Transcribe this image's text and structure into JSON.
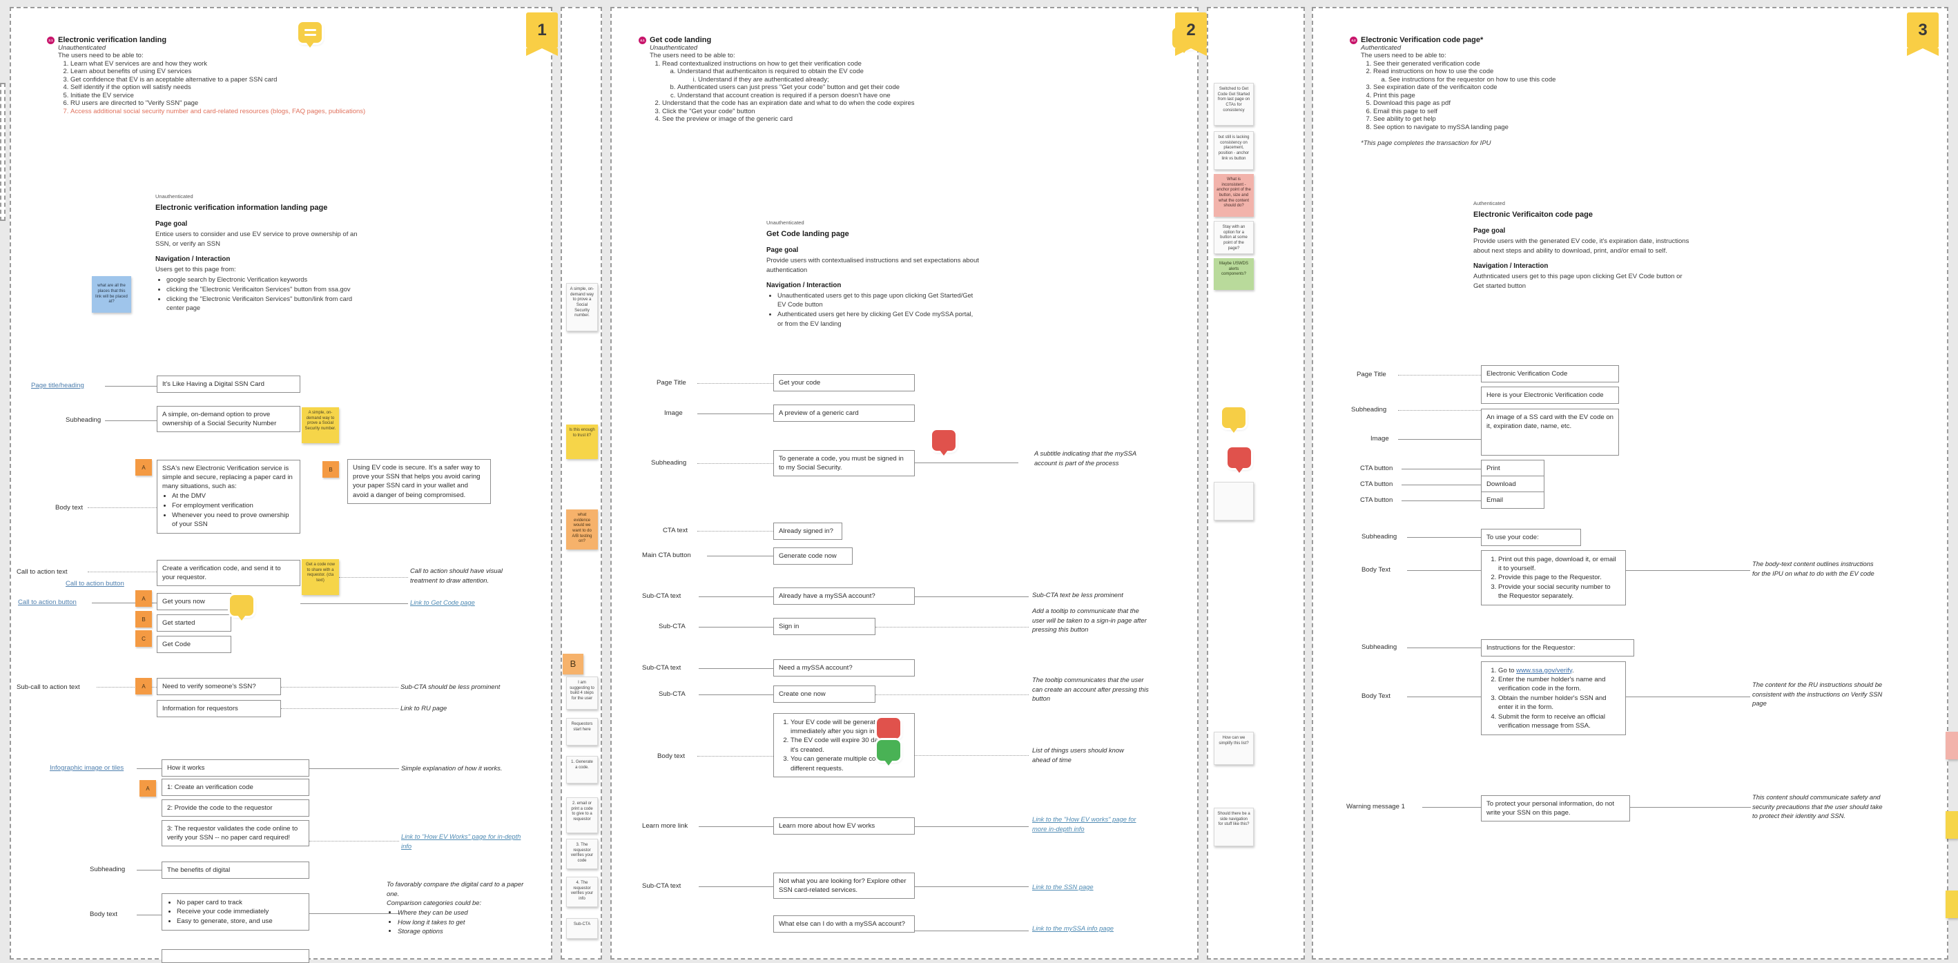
{
  "board": {
    "frames": [
      {
        "badge": "1"
      },
      {
        "badge": "2"
      },
      {
        "badge": "3"
      }
    ]
  },
  "panel1": {
    "header": {
      "number": "2.1",
      "title": "Electronic verification landing",
      "auth": "Unauthenticated",
      "intro": "The users need to be able to:",
      "items": [
        "Learn what EV services are and how they work",
        "Learn about benefits of using EV services",
        "Get confidence that EV is an aceptable alternative to a paper SSN card",
        "Self identify if the option will satisfy needs",
        "Initiate the EV service",
        "RU users are direcrted to \"Verify SSN\" page",
        "Access additional social security number and card-related resources (blogs, FAQ pages, publications)"
      ]
    },
    "goal": {
      "auth": "Unauthenticated",
      "page_name": "Electronic verification information landing page",
      "goal_label": "Page goal",
      "goal_text": "Entice users to consider and use EV service to prove ownership of an SSN, or verify an SSN",
      "nav_label": "Navigation / Interaction",
      "nav_intro": "Users get to this page from:",
      "nav_items": [
        "google search by Electronic Verification keywords",
        "clicking the \"Electronic Verificaiton Services\" button from ssa.gov",
        "clicking the \"Electronic Verificaiton Services\" button/link from card center page"
      ]
    },
    "labels": {
      "page_title": "Page title/heading",
      "subheading": "Subheading",
      "body_text": "Body text",
      "cta_text": "Call to action text",
      "cta_button": "Call to action button",
      "cta_button2": "Call to action button",
      "sub_cta_text": "Sub-call to action text",
      "infographic": "Infographic image or tiles",
      "subheading2": "Subheading",
      "body_text2": "Body text"
    },
    "boxes": {
      "page_title": "It's Like Having a Digital SSN Card",
      "subheading": "A simple, on-demand option to prove ownership of a Social Security Number",
      "body_a_intro": "SSA's new Electronic Verification service is simple and secure, replacing a paper card in many situations, such as:",
      "body_a_items": [
        "At the DMV",
        "For employment verification",
        "Whenever you need to prove ownership of your SSN"
      ],
      "body_b": "Using EV code is secure. It's a safer way to prove your SSN that helps you avoid caring your paper SSN card in your wallet and avoid a danger of being compromised.",
      "cta_text": "Create a verification code, and send it to your requestor.",
      "cta_a": "Get yours now",
      "cta_b": "Get started",
      "cta_c": "Get Code",
      "sub_cta_a": "Need to verify someone's SSN?",
      "sub_cta_b": "Information for requestors",
      "infographic": "How it works",
      "step1": "1: Create an  verification code",
      "step2": "2: Provide the code to the requestor",
      "step3": "3: The requestor validates the code online to verify your SSN -- no paper card required!",
      "subheading2": "The benefits of digital",
      "benefits": [
        "No paper card to track",
        "Receive your code immediately",
        "Easy to generate, store, and use"
      ]
    },
    "annotations": {
      "cta_visual": "Call to action should have visual treatment to draw attention.",
      "link_getcode": "Link to Get Code page",
      "sub_cta_prominent": "Sub-CTA should be less prominent",
      "link_ru": "Link to RU page",
      "simple_explanation": "Simple explanation of how it works.",
      "link_how_ev": "Link to \"How EV Works\" page for in-depth info",
      "compare_intro": "To favorably compare the digital card to a paper one.",
      "compare_intro2": "Comparison categories could be:",
      "compare_items": [
        "Where they can be used",
        "How long it takes to get",
        "Storage options"
      ]
    },
    "stickies": {
      "blue_link_places": "what are all the places that this link will be placed at?",
      "yellow_subhead": "A simple, on-demand way to prove a Social Security number.",
      "yellow_cta": "Get a code now to share with a requestor. (cta text)"
    },
    "vtabs": [
      "A",
      "B",
      "A",
      "B",
      "C",
      "A",
      "A"
    ]
  },
  "panel2": {
    "header": {
      "number": "4.1",
      "title": "Get code landing",
      "auth": "Unauthenticated",
      "intro": "The users need to be able to:",
      "items": [
        {
          "text": "Read contextualized instructions on how to get their verification code",
          "sub": [
            {
              "text": "Understand that authenticaiton is required to obtain the EV code",
              "sub": [
                "Understand if they are authenticated already;"
              ]
            },
            {
              "text": "Authenticated users can just press \"Get your code\" button and get their code",
              "sub": []
            },
            {
              "text": "Understand that account creation is required if a person doesn't have one",
              "sub": []
            }
          ]
        },
        {
          "text": "Understand that the code has an expiration date and what to do when the code expires",
          "sub": []
        },
        {
          "text": "Click the \"Get your code\" button",
          "sub": []
        },
        {
          "text": "See the preview or image of the generic card",
          "sub": []
        }
      ]
    },
    "goal": {
      "auth": "Unauthenticated",
      "page_name": "Get Code landing page",
      "goal_label": "Page goal",
      "goal_text": "Provide users with contextualised instructions and set expectations about authentication",
      "nav_label": "Navigation / Interaction",
      "nav_items": [
        "Unauthenticated users get to this page upon clicking Get Started/Get EV Code button",
        "Authenticated users get here by clicking Get EV Code mySSA portal, or from the EV landing"
      ]
    },
    "labels": {
      "page_title": "Page Title",
      "image": "Image",
      "subheading": "Subheading",
      "cta_text": "CTA text",
      "main_cta": "Main CTA button",
      "sub_cta_text1": "Sub-CTA text",
      "sub_cta1": "Sub-CTA",
      "sub_cta_text2": "Sub-CTA text",
      "sub_cta2": "Sub-CTA",
      "body_text": "Body text",
      "learn_more": "Learn more link",
      "sub_cta_text3": "Sub-CTA text"
    },
    "boxes": {
      "page_title": "Get your code",
      "image": "A preview of a generic card",
      "subheading": "To generate a code, you must be signed in to my Social Security.",
      "cta_text": "Already signed in?",
      "main_cta": "Generate code now",
      "sub_cta_text1": "Already have a mySSA account?",
      "sub_cta1": "Sign in",
      "sub_cta_text2": "Need a mySSA account?",
      "sub_cta2": "Create one now",
      "body_items": [
        "Your EV code will be generated immediately after you sign in.",
        "The EV code will expire 30 days after it's created.",
        "You can generate multiple codes for different requests."
      ],
      "learn_more": "Learn more about how EV works",
      "sub_cta_text3": "Not what you are looking for? Explore other SSN card-related services.",
      "myssa_q": "What else can I do with a mySSA account?"
    },
    "annotations": {
      "subtitle_note": "A subtitle indicating that the mySSA account is part of the process",
      "sub_cta_prominent": "Sub-CTA text be less prominent",
      "tooltip_signin": "Add a tooltip to communicate that the user will be taken to a sign-in page after pressing this button",
      "tooltip_create": "The tooltip communicates that the user can create an account after pressing this button",
      "list_of_things": "List of things users should know ahead of time",
      "link_how_ev": "Link to the \"How EV works\" page for  more in-depth info",
      "link_ssn": "Link to the SSN page",
      "link_myssa": "Link to the mySSA info page"
    }
  },
  "panel3": {
    "header": {
      "number": "4.2",
      "title": "Electronic Verification code page*",
      "auth": "Authenticated",
      "intro": "The users need to be able to:",
      "items": [
        {
          "text": "See their generated verification code",
          "sub": []
        },
        {
          "text": "Read instructions on how to use the code",
          "sub": [
            "See instructions for the requestor on how to use this code"
          ]
        },
        {
          "text": "See expiration date of the verificaiton code",
          "sub": []
        },
        {
          "text": "Print this page",
          "sub": []
        },
        {
          "text": "Download this page as pdf",
          "sub": []
        },
        {
          "text": "Email this page to self",
          "sub": []
        },
        {
          "text": "See ability to get help",
          "sub": []
        },
        {
          "text": "See option to navigate to mySSA landing page",
          "sub": []
        }
      ],
      "footnote": "*This page completes the transaction for IPU"
    },
    "goal": {
      "auth": "Authenticated",
      "page_name": "Electronic Verificaiton code page",
      "goal_label": "Page goal",
      "goal_text": "Provide users with the generated EV code, it's expiration date, instructions about next steps and ability to download, print, and/or email to self.",
      "nav_label": "Navigation / Interaction",
      "nav_text": "Authnticated users get to this page upon clicking Get EV Code button or Get started button"
    },
    "labels": {
      "page_title": "Page Title",
      "subheading": "Subheading",
      "image": "Image",
      "cta1": "CTA button",
      "cta2": "CTA button",
      "cta3": "CTA button",
      "subheading2": "Subheading",
      "body_text": "Body Text",
      "subheading3": "Subheading",
      "body_text2": "Body Text",
      "warning": "Warning message 1"
    },
    "boxes": {
      "page_title": "Electronic Verification Code",
      "subheading": "Here is your Electronic Verification code",
      "image": "An image of a SS card with the EV code on it, expiration date, name, etc.",
      "cta1": "Print",
      "cta2": "Download",
      "cta3": "Email",
      "subheading2": "To use your code:",
      "body_items": [
        "Print out this page, download it, or email it to yourself.",
        "Provide this page to the Requestor.",
        "Provide your social security number to the Requestor separately."
      ],
      "subheading3": "Instructions for the Requestor:",
      "requestor_link": "www.ssa.gov/verify",
      "requestor_items": [
        "Enter the number holder's name and verification code in the form.",
        "Obtain the number holder's SSN and enter it in the form.",
        "Submit the form to receive an official verification message from SSA."
      ],
      "requestor_item1_prefix": "Go to ",
      "warning": "To protect your personal information, do not write your SSN on this page."
    },
    "annotations": {
      "body_outline": "The body-text content outlines instructions for the IPU on what to do with the EV code",
      "ru_consistent": "The content for the RU instructions should be consistent with the instructions on Verify SSN page",
      "warning_note": "This content should communicate safety and security precautions that the user should take to protect their identity and SSN."
    }
  },
  "strip_notes": {
    "left": [
      "A simple, on-demand way to prove a Social Security number.",
      "Is this enough to trust it?",
      "what evidence would we want to do A/B testing on?",
      "B",
      "I am suggesting to build 4 steps for the user",
      "Requestors start here",
      "1. Generate a code.",
      "2. email or print a code to give to a requestor",
      "3. The requestor verifies your code",
      "4. The requestor verifies your info",
      "Sub-CTA"
    ],
    "mid": [
      "Switched to Get Code Get Started from last page on CTAs for consistency",
      "but still is lacking consistency on placement, position - anchor link vs button",
      "What is inconsistent - anchor point of the button, size and what the content should do?",
      "Stay with an option for a button at some point of the page?",
      "Maybe USWDS alerts components?",
      "How can we simplify this list?",
      "Should there be a side navigation for stuff like this?"
    ]
  }
}
